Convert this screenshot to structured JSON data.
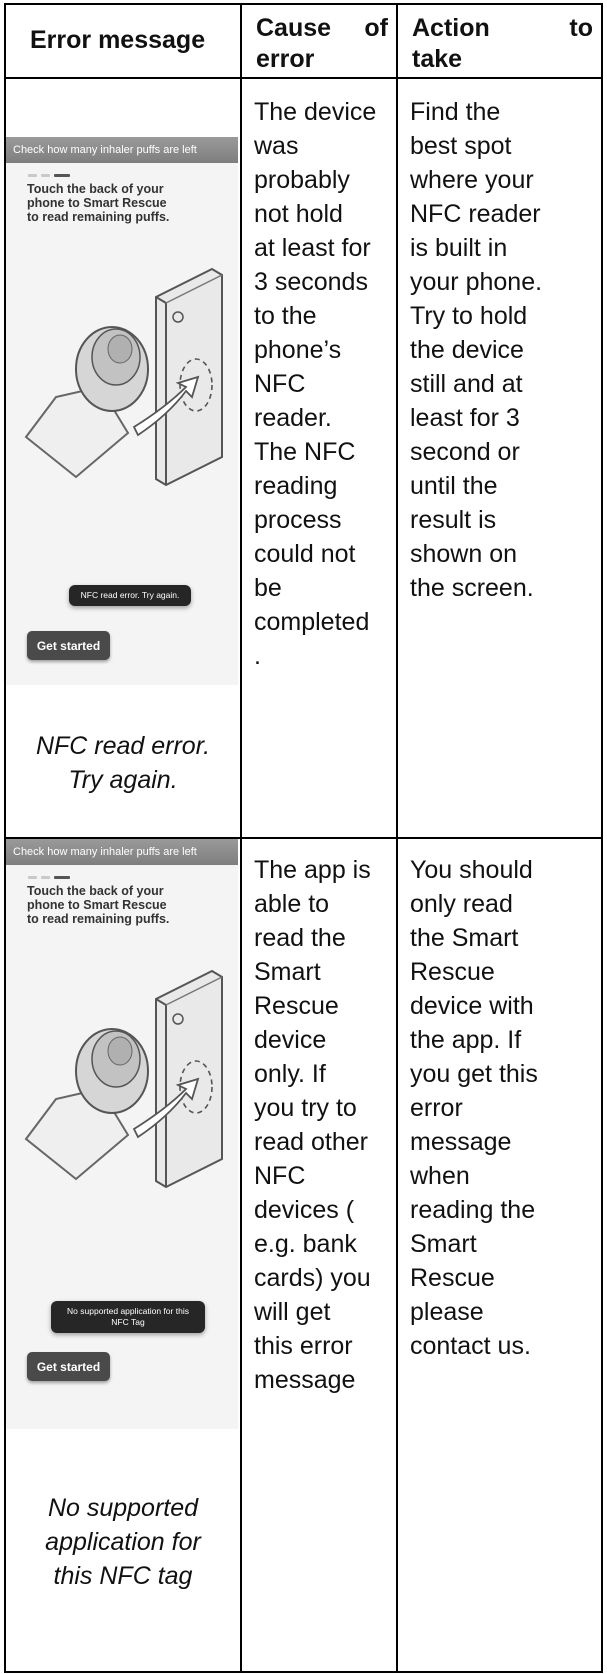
{
  "table": {
    "headers": {
      "error_message": "Error message",
      "cause_line1": "Cause of",
      "cause_line2": "error",
      "action_line1": "Action to",
      "action_line2": "take"
    },
    "rows": [
      {
        "screenshot": {
          "title_bar": "Check how many inhaler puffs are left",
          "instruction": "Touch the back of your\nphone to Smart Rescue\nto read remaining puffs.",
          "toast": "NFC read error. Try again.",
          "button": "Get started"
        },
        "caption": "NFC read error.\nTry again.",
        "cause": "The device\nwas\nprobably\nnot hold\nat least for\n3 seconds\nto the\nphone’s\nNFC\nreader.\nThe NFC\nreading\nprocess\ncould not\nbe\ncompleted\n.",
        "action": "Find the\nbest spot\nwhere your\nNFC reader\nis built in\nyour phone.\nTry to hold\nthe device\nstill and at\nleast for 3\nsecond or\nuntil the\nresult is\nshown on\nthe screen."
      },
      {
        "screenshot": {
          "title_bar": "Check how many inhaler puffs are left",
          "instruction": "Touch the back of your\nphone to Smart Rescue\nto read remaining puffs.",
          "toast": "No supported application for this\nNFC Tag",
          "button": "Get started"
        },
        "caption": "No supported\napplication for\nthis NFC tag",
        "cause": "The app is\nable to\nread the\nSmart\nRescue\ndevice\nonly. If\nyou try to\nread other\nNFC\ndevices (\ne.g. bank\ncards) you\nwill get\nthis error\nmessage",
        "action": "You should\nonly read\nthe Smart\nRescue\ndevice with\nthe app. If\nyou get this\nerror\nmessage\nwhen\nreading the\nSmart\nRescue\nplease\ncontact us."
      }
    ]
  },
  "icons": [
    "inhaler-icon",
    "phone-icon",
    "nfc-arrow-icon"
  ]
}
